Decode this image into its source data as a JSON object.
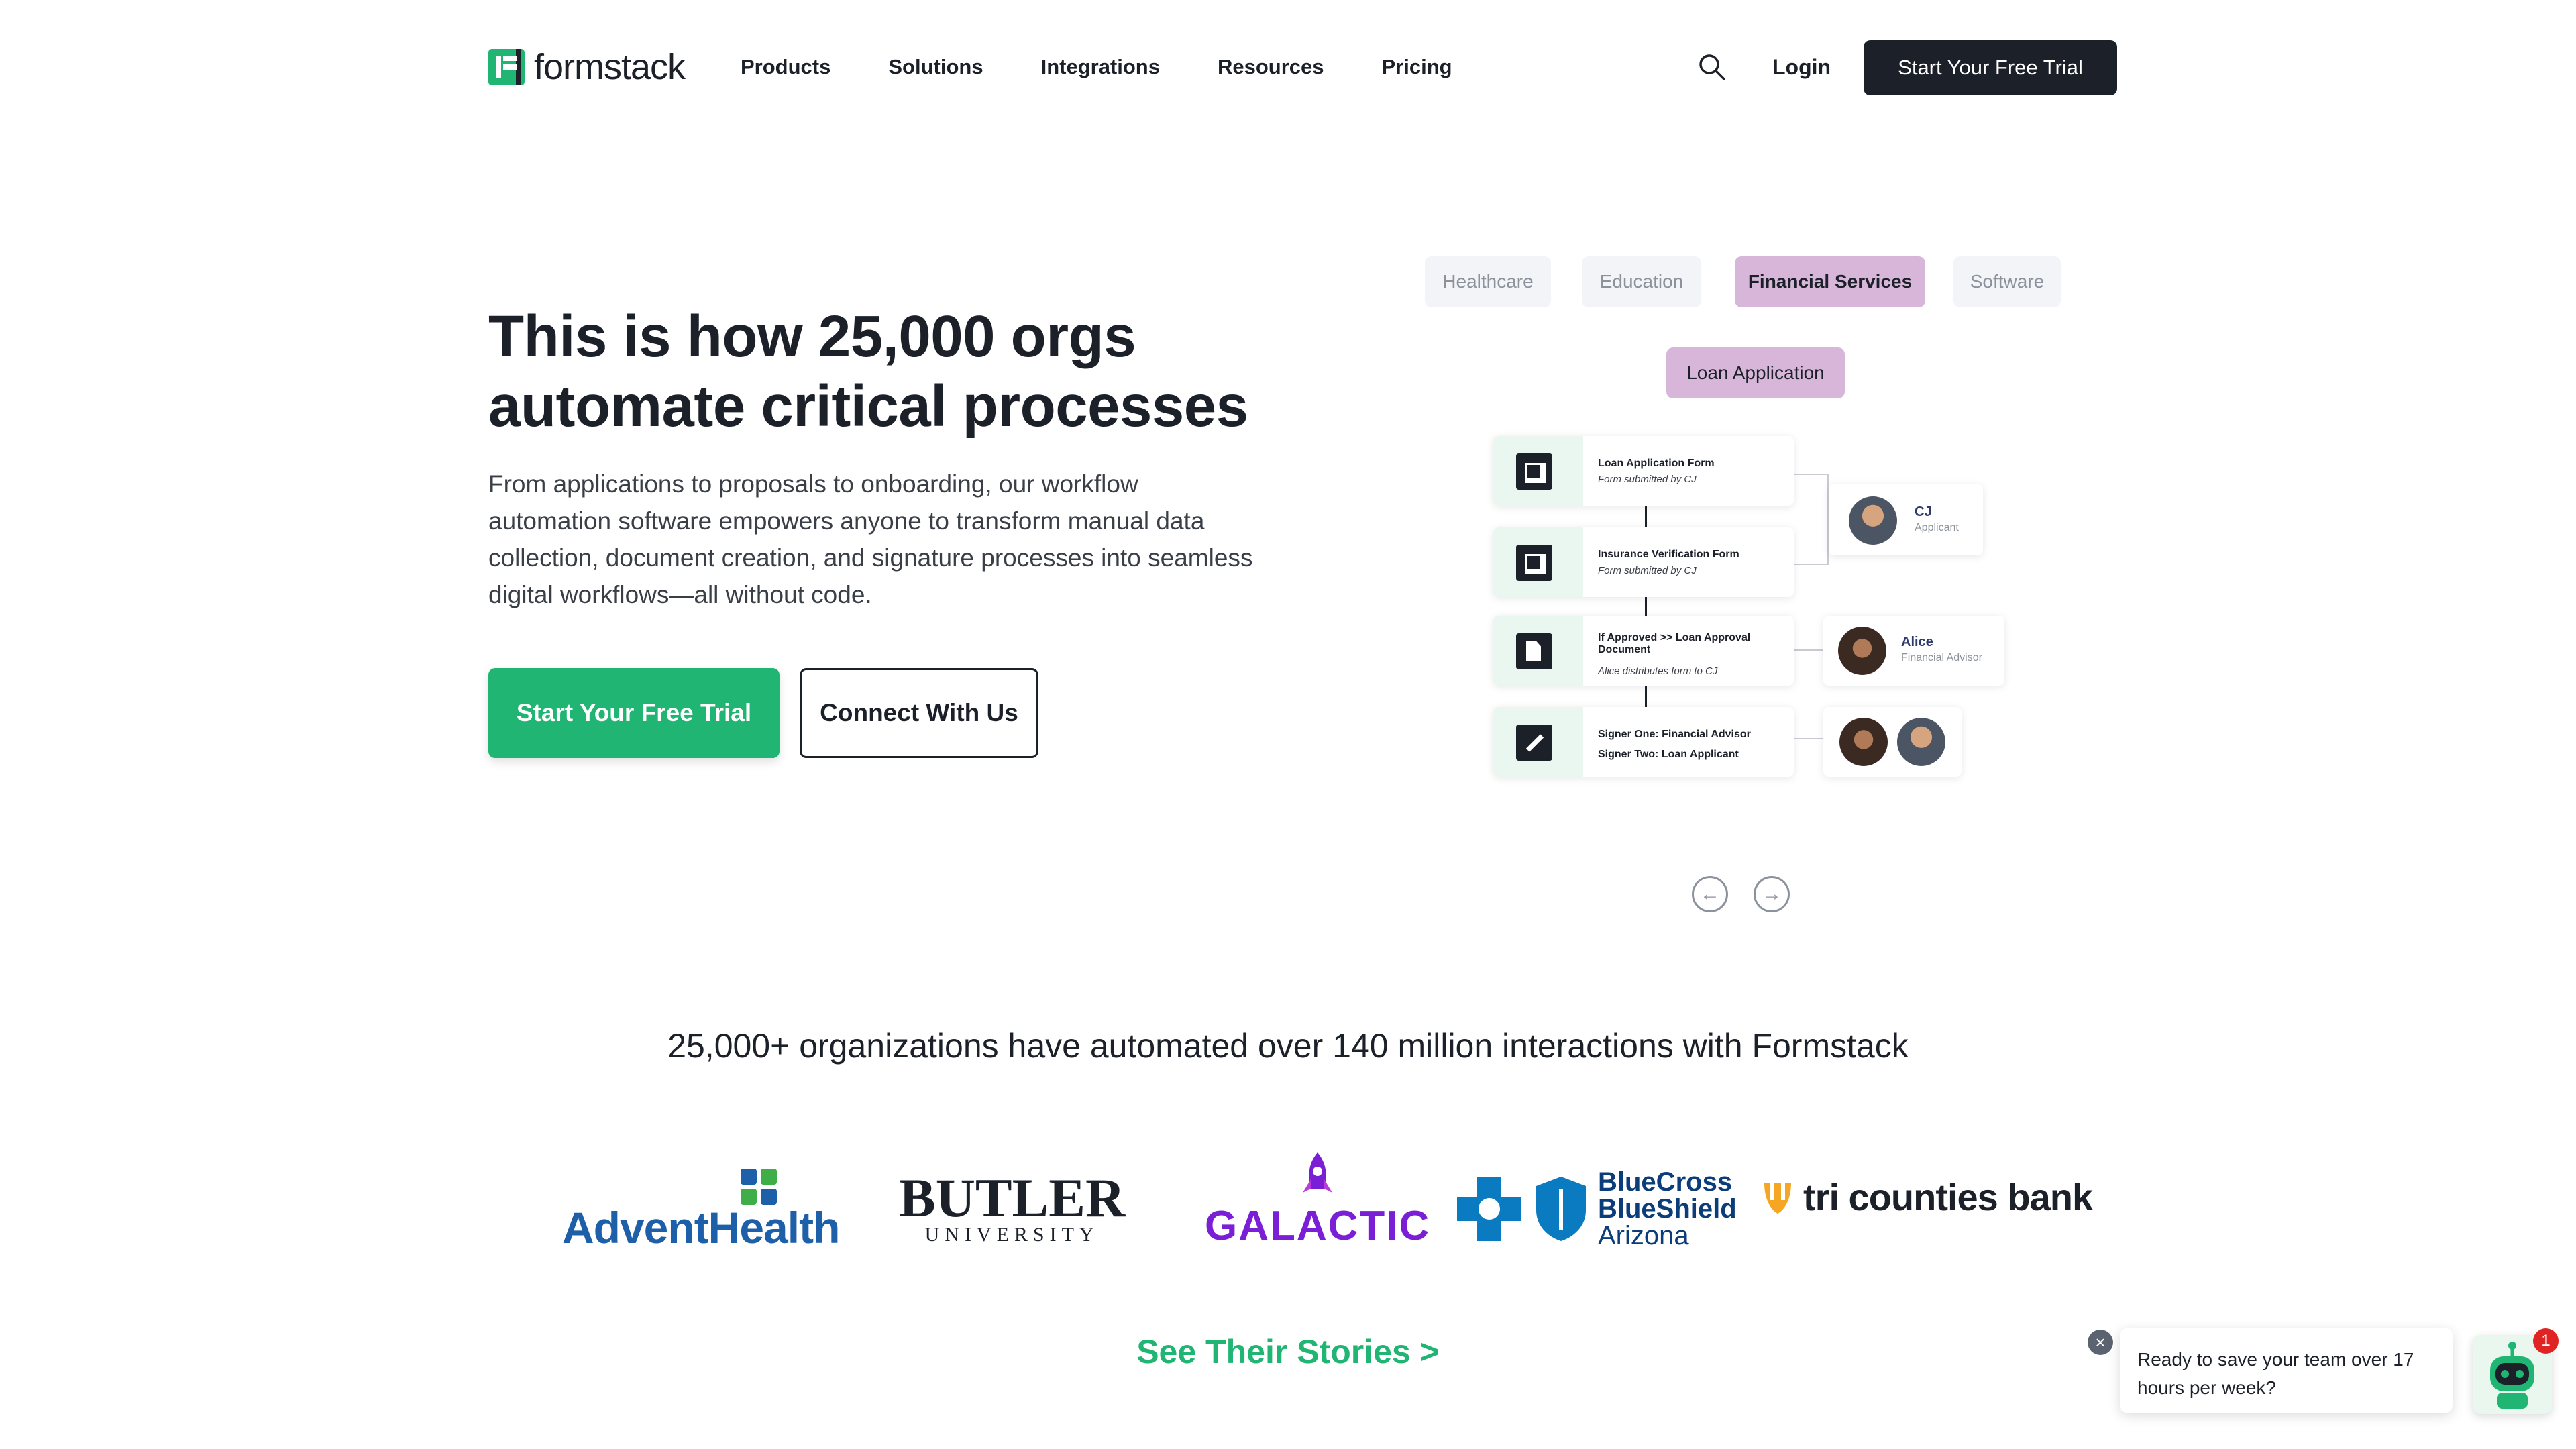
{
  "header": {
    "logo_text": "formstack",
    "nav": [
      "Products",
      "Solutions",
      "Integrations",
      "Resources",
      "Pricing"
    ],
    "login": "Login",
    "cta": "Start Your Free Trial"
  },
  "hero": {
    "title": "This is how 25,000 orgs automate critical processes",
    "description": "From applications to proposals to onboarding, our workflow automation software empowers anyone to transform manual data collection, document creation, and signature processes into seamless digital workflows—all without code.",
    "primary_button": "Start Your Free Trial",
    "secondary_button": "Connect With Us"
  },
  "showcase": {
    "tabs": [
      {
        "label": "Healthcare",
        "active": false
      },
      {
        "label": "Education",
        "active": false
      },
      {
        "label": "Financial Services",
        "active": true
      },
      {
        "label": "Software",
        "active": false
      }
    ],
    "workflow_name": "Loan Application",
    "steps": [
      {
        "title": "Loan Application Form",
        "sub": "Form submitted by CJ",
        "icon": "form-icon"
      },
      {
        "title": "Insurance Verification Form",
        "sub": "Form submitted by CJ",
        "icon": "form-icon"
      },
      {
        "title": "If Approved >> Loan Approval Document",
        "sub": "Alice distributes form to CJ",
        "icon": "document-icon"
      },
      {
        "title": "Signer One: Financial Advisor",
        "sub": "Signer Two: Loan Applicant",
        "icon": "pen-icon"
      }
    ],
    "people": [
      {
        "name": "CJ",
        "role": "Applicant"
      },
      {
        "name": "Alice",
        "role": "Financial Advisor"
      }
    ]
  },
  "stats": "25,000+ organizations have automated over 140 million interactions with Formstack",
  "logos": {
    "advent": "AdventHealth",
    "butler_main": "BUTLER",
    "butler_sub": "UNIVERSITY",
    "galactic": "GALACTIC",
    "bcbs_line1": "BlueCross",
    "bcbs_line2": "BlueShield",
    "bcbs_line3": "Arizona",
    "tcb": "tri counties bank"
  },
  "see_stories": "See Their Stories >",
  "chat": {
    "message": "Ready to save your team over 17 hours per week?",
    "badge_count": "1"
  },
  "colors": {
    "brand_green": "#21b573",
    "dark": "#1b2029",
    "tab_active": "#d7b6d9"
  }
}
